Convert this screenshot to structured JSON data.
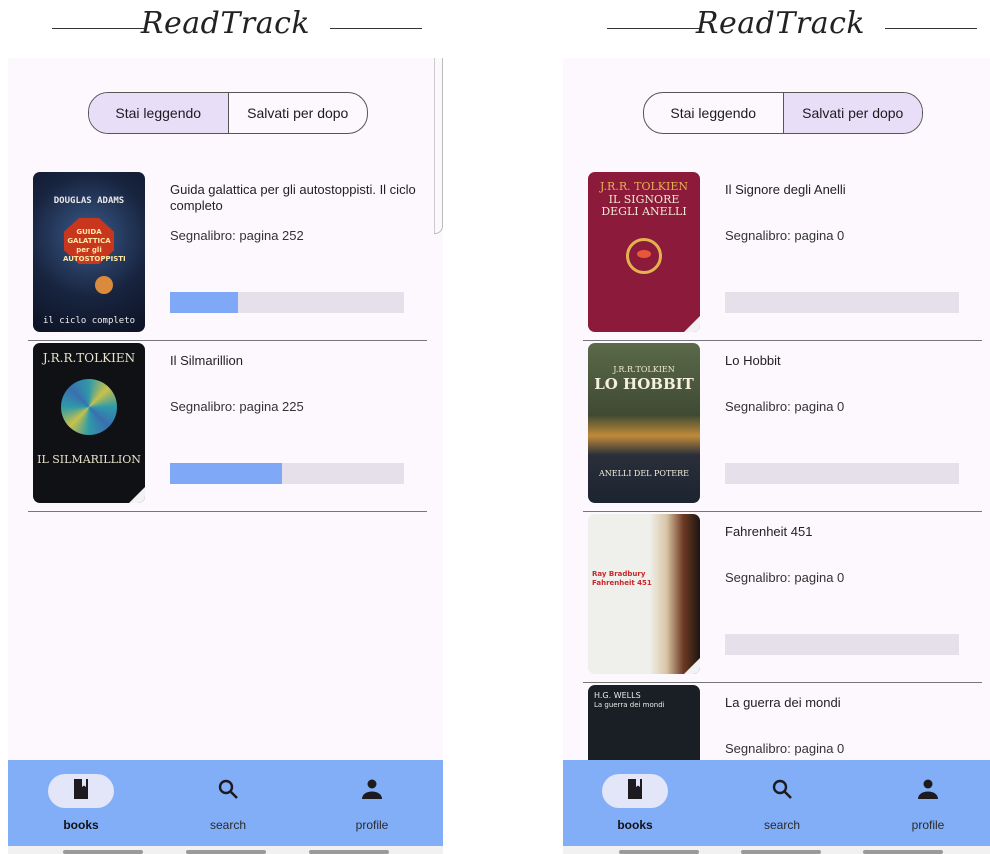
{
  "app": {
    "title": "ReadTrack"
  },
  "colors": {
    "accent": "#82aef8",
    "selected_segment": "#e8def8",
    "progress_fill": "#7fa9f7",
    "progress_track": "#e6e0ea"
  },
  "tabs": {
    "reading": "Stai leggendo",
    "saved": "Salvati per dopo"
  },
  "screens": [
    {
      "selected_tab": "reading",
      "books": [
        {
          "title": "Guida galattica per gli autostoppisti. Il ciclo completo",
          "bookmark": "Segnalibro: pagina 252",
          "progress": 0.29,
          "cover": {
            "author": "DOUGLAS ADAMS",
            "name": "GUIDA GALATTICA per gli AUTOSTOPPISTI",
            "footer": "il ciclo completo"
          }
        },
        {
          "title": "Il Silmarillion",
          "bookmark": "Segnalibro: pagina 225",
          "progress": 0.48,
          "cover": {
            "author": "J.R.R.TOLKIEN",
            "name": "IL SILMARILLION"
          }
        }
      ]
    },
    {
      "selected_tab": "saved",
      "books": [
        {
          "title": "Il Signore degli Anelli",
          "bookmark": "Segnalibro: pagina 0",
          "progress": 0,
          "cover": {
            "author": "J.R.R. TOLKIEN",
            "name": "IL SIGNORE DEGLI ANELLI"
          }
        },
        {
          "title": "Lo Hobbit",
          "bookmark": "Segnalibro: pagina 0",
          "progress": 0,
          "cover": {
            "author": "J.R.R.TOLKIEN",
            "name": "LO HOBBIT",
            "footer": "ANELLI DEL POTERE"
          }
        },
        {
          "title": "Fahrenheit 451",
          "bookmark": "Segnalibro: pagina 0",
          "progress": 0,
          "cover": {
            "author": "Ray Bradbury",
            "name": "Fahrenheit 451"
          }
        },
        {
          "title": "La guerra dei mondi",
          "bookmark": "Segnalibro: pagina 0",
          "progress": 0,
          "cover": {
            "author": "H.G. WELLS",
            "name": "La guerra dei mondi"
          }
        }
      ]
    }
  ],
  "nav": [
    {
      "label": "books",
      "icon": "book-icon",
      "active": true
    },
    {
      "label": "search",
      "icon": "search-icon",
      "active": false
    },
    {
      "label": "profile",
      "icon": "person-icon",
      "active": false
    }
  ]
}
